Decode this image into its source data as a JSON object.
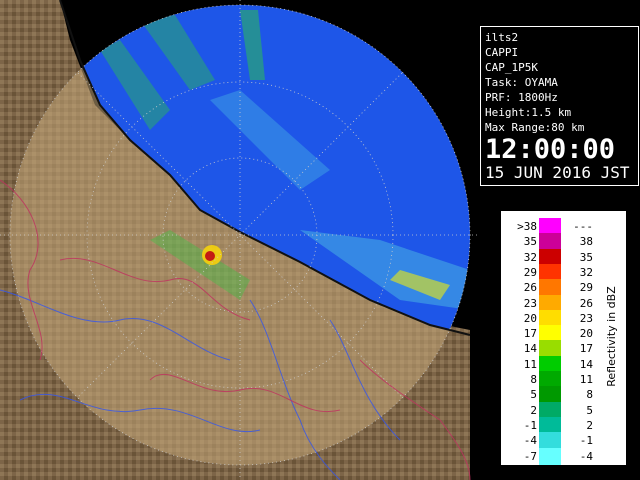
{
  "info": {
    "site": "ilts2",
    "product": "CAPPI",
    "product_code": "CAP_1P5K",
    "task": "Task: OYAMA",
    "prf": "PRF: 1800Hz",
    "height": "Height:1.5 km",
    "max_range": "Max Range:80 km",
    "time": "12:00:00",
    "date": "15 JUN 2016 JST"
  },
  "legend": {
    "unit": "Reflectivity in dBZ",
    "rows": [
      {
        "lo": ">38",
        "hi": "---",
        "color": "#ff00ff"
      },
      {
        "lo": "35",
        "hi": "38",
        "color": "#cc0099"
      },
      {
        "lo": "32",
        "hi": "35",
        "color": "#cc0000"
      },
      {
        "lo": "29",
        "hi": "32",
        "color": "#ff3300"
      },
      {
        "lo": "26",
        "hi": "29",
        "color": "#ff7700"
      },
      {
        "lo": "23",
        "hi": "26",
        "color": "#ffaa00"
      },
      {
        "lo": "20",
        "hi": "23",
        "color": "#ffdd00"
      },
      {
        "lo": "17",
        "hi": "20",
        "color": "#ffff00"
      },
      {
        "lo": "14",
        "hi": "17",
        "color": "#99dd00"
      },
      {
        "lo": "11",
        "hi": "14",
        "color": "#00cc00"
      },
      {
        "lo": "8",
        "hi": "11",
        "color": "#00aa00"
      },
      {
        "lo": "5",
        "hi": "8",
        "color": "#009900"
      },
      {
        "lo": "2",
        "hi": "5",
        "color": "#00aa66"
      },
      {
        "lo": "-1",
        "hi": "2",
        "color": "#00bb99"
      },
      {
        "lo": "-4",
        "hi": "-1",
        "color": "#33dddd"
      },
      {
        "lo": "-7",
        "hi": "-4",
        "color": "#66ffff"
      }
    ]
  },
  "colors": {
    "sea": "#1e56e8",
    "land": "#8a7050",
    "echo_green": "#2ecc40",
    "echo_cyan": "#5fe3e3"
  }
}
